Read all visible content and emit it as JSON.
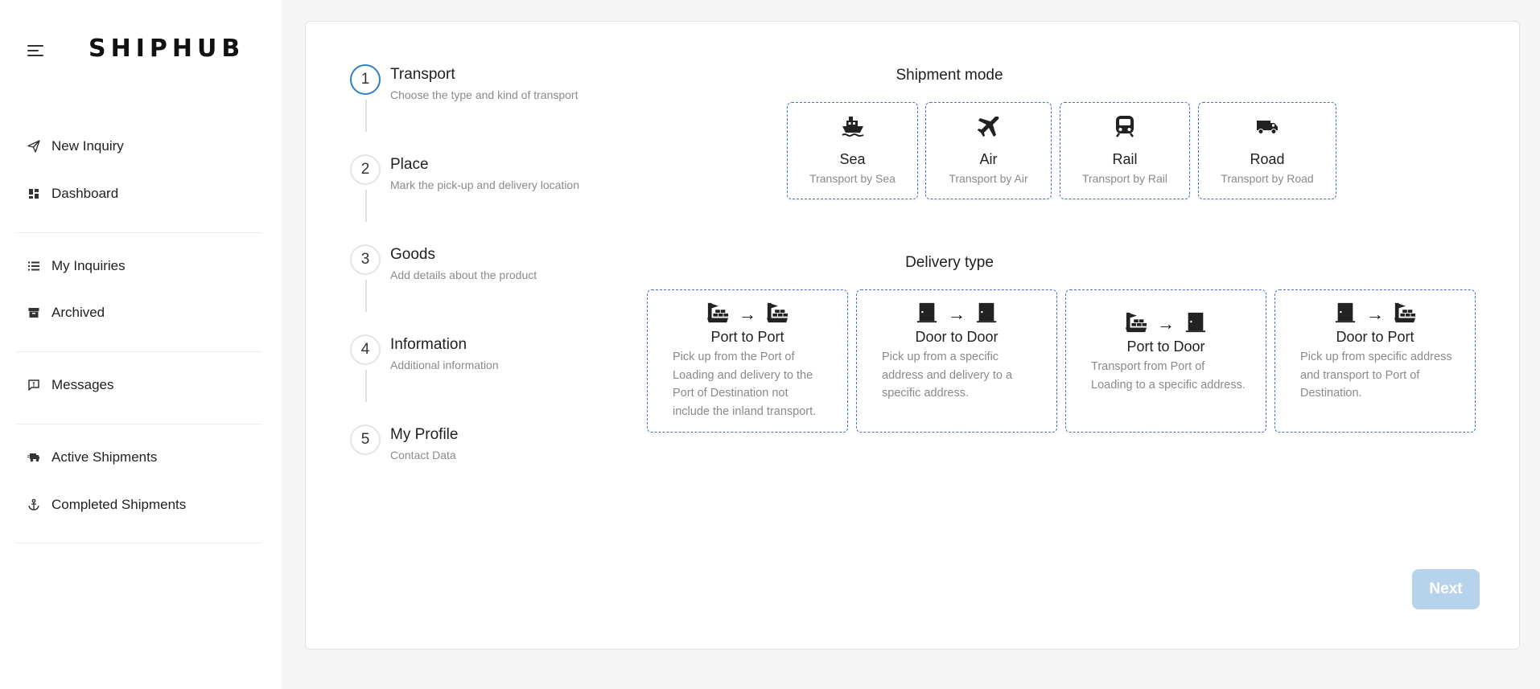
{
  "brand": {
    "logo_text": "SHIPHUB"
  },
  "sidebar": {
    "groups": [
      [
        {
          "label": "New Inquiry",
          "icon": "send-icon"
        },
        {
          "label": "Dashboard",
          "icon": "dashboard-icon"
        }
      ],
      [
        {
          "label": "My Inquiries",
          "icon": "list-icon"
        },
        {
          "label": "Archived",
          "icon": "archive-icon"
        }
      ],
      [
        {
          "label": "Messages",
          "icon": "message-icon"
        }
      ],
      [
        {
          "label": "Active Shipments",
          "icon": "truck-fast-icon"
        },
        {
          "label": "Completed Shipments",
          "icon": "anchor-icon"
        }
      ]
    ]
  },
  "stepper": {
    "steps": [
      {
        "number": "1",
        "title": "Transport",
        "subtitle": "Choose the type and kind of transport",
        "active": true
      },
      {
        "number": "2",
        "title": "Place",
        "subtitle": "Mark the pick-up and delivery location",
        "active": false
      },
      {
        "number": "3",
        "title": "Goods",
        "subtitle": "Add details about the product",
        "active": false
      },
      {
        "number": "4",
        "title": "Information",
        "subtitle": "Additional information",
        "active": false
      },
      {
        "number": "5",
        "title": "My Profile",
        "subtitle": "Contact Data",
        "active": false
      }
    ]
  },
  "shipment_mode": {
    "title": "Shipment mode",
    "options": [
      {
        "label": "Sea",
        "subtitle": "Transport by Sea",
        "icon": "ship-icon"
      },
      {
        "label": "Air",
        "subtitle": "Transport by Air",
        "icon": "plane-icon"
      },
      {
        "label": "Rail",
        "subtitle": "Transport by Rail",
        "icon": "train-icon"
      },
      {
        "label": "Road",
        "subtitle": "Transport by Road",
        "icon": "truck-icon"
      }
    ]
  },
  "delivery_type": {
    "title": "Delivery type",
    "options": [
      {
        "label": "Port to Port",
        "description": "Pick up from the Port of Loading and delivery to the Port of Destination not include the inland transport.",
        "from_icon": "port-icon",
        "to_icon": "port-icon"
      },
      {
        "label": "Door to Door",
        "description": "Pick up from a specific address and delivery to a specific address.",
        "from_icon": "door-icon",
        "to_icon": "door-icon"
      },
      {
        "label": "Port to Door",
        "description": "Transport from Port of Loading to a specific address.",
        "from_icon": "port-icon",
        "to_icon": "door-icon"
      },
      {
        "label": "Door to Port",
        "description": "Pick up from specific address and transport to Port of Destination.",
        "from_icon": "door-icon",
        "to_icon": "port-icon"
      }
    ]
  },
  "actions": {
    "next_label": "Next"
  },
  "colors": {
    "accent": "#2f80c8",
    "card_border": "#4a72b8",
    "next_disabled": "#b7d3ec"
  }
}
